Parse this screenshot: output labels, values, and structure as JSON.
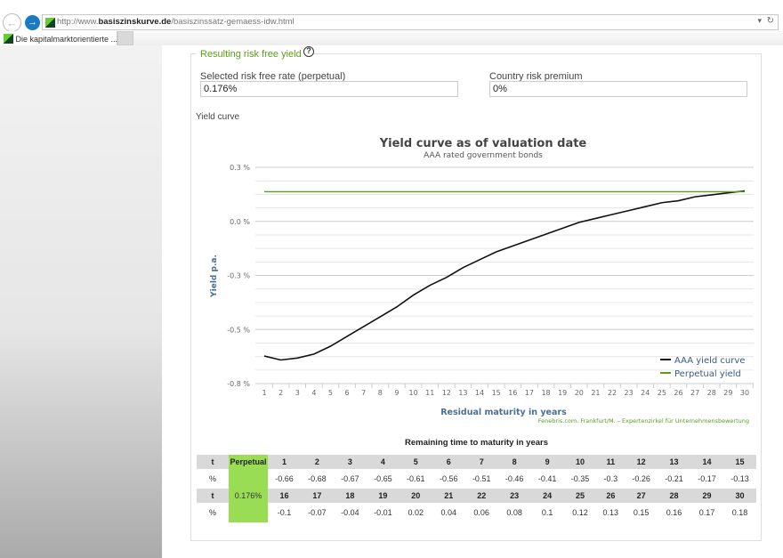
{
  "browser": {
    "url_prefix": "http://www.",
    "url_domain": "basiszinskurve.de",
    "url_path": "/basiszinssatz-gemaess-idw.html",
    "tab_title": "Die kapitalmarktorientierte ...",
    "tab_close": "×",
    "dropdown": "▾",
    "refresh": "↻"
  },
  "section": {
    "legend": "Resulting risk free yield",
    "help": "?",
    "risk_free_label": "Selected risk free rate (perpetual)",
    "risk_free_value": "0.176%",
    "country_label": "Country risk premium",
    "country_value": "0%",
    "yield_curve_label": "Yield curve"
  },
  "chart_data": {
    "type": "line",
    "title": "Yield curve as of valuation date",
    "subtitle": "AAA rated government bonds",
    "xlabel": "Residual maturity in years",
    "ylabel": "Yield p.a.",
    "credit": "Fenebris.com. Frankfurt/M. – Expertenzirkel für Unternehmensbewertung",
    "ylim": [
      -0.8,
      0.3
    ],
    "yticks": [
      "0.3 %",
      "0.0 %",
      "-0.3 %",
      "-0.5 %",
      "-0.8 %"
    ],
    "x": [
      1,
      2,
      3,
      4,
      5,
      6,
      7,
      8,
      9,
      10,
      11,
      12,
      13,
      14,
      15,
      16,
      17,
      18,
      19,
      20,
      21,
      22,
      23,
      24,
      25,
      26,
      27,
      28,
      29,
      30
    ],
    "grid": true,
    "legend_position": "bottom-right",
    "series": [
      {
        "name": "AAA yield curve",
        "color": "#111111",
        "values": [
          -0.66,
          -0.68,
          -0.67,
          -0.65,
          -0.61,
          -0.56,
          -0.51,
          -0.46,
          -0.41,
          -0.35,
          -0.3,
          -0.26,
          -0.21,
          -0.17,
          -0.13,
          -0.1,
          -0.07,
          -0.04,
          -0.01,
          0.02,
          0.04,
          0.06,
          0.08,
          0.1,
          0.12,
          0.13,
          0.15,
          0.16,
          0.17,
          0.18
        ]
      },
      {
        "name": "Perpetual yield",
        "color": "#5a9d1a",
        "values": [
          0.176,
          0.176,
          0.176,
          0.176,
          0.176,
          0.176,
          0.176,
          0.176,
          0.176,
          0.176,
          0.176,
          0.176,
          0.176,
          0.176,
          0.176,
          0.176,
          0.176,
          0.176,
          0.176,
          0.176,
          0.176,
          0.176,
          0.176,
          0.176,
          0.176,
          0.176,
          0.176,
          0.176,
          0.176,
          0.176
        ]
      }
    ]
  },
  "table": {
    "title": "Remaining time to maturity in years",
    "t_label": "t",
    "pct_label": "%",
    "perpetual_label": "Perpetual",
    "perpetual_value": "0.176%",
    "row1_t": [
      "1",
      "2",
      "3",
      "4",
      "5",
      "6",
      "7",
      "8",
      "9",
      "10",
      "11",
      "12",
      "13",
      "14",
      "15"
    ],
    "row1_v": [
      "-0.66",
      "-0.68",
      "-0.67",
      "-0.65",
      "-0.61",
      "-0.56",
      "-0.51",
      "-0.46",
      "-0.41",
      "-0.35",
      "-0.3",
      "-0.26",
      "-0.21",
      "-0.17",
      "-0.13"
    ],
    "row2_t": [
      "16",
      "17",
      "18",
      "19",
      "20",
      "21",
      "22",
      "23",
      "24",
      "25",
      "26",
      "27",
      "28",
      "29",
      "30"
    ],
    "row2_v": [
      "-0.1",
      "-0.07",
      "-0.04",
      "-0.01",
      "0.02",
      "0.04",
      "0.06",
      "0.08",
      "0.1",
      "0.12",
      "0.13",
      "0.15",
      "0.16",
      "0.17",
      "0.18"
    ]
  }
}
